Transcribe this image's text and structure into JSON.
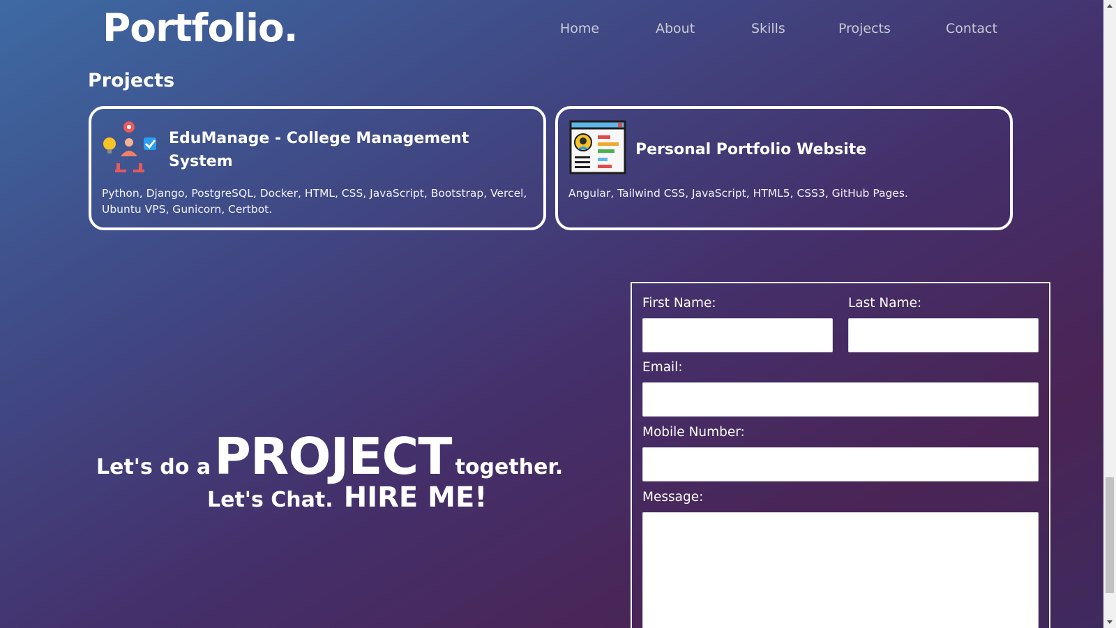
{
  "header": {
    "logo": "Portfolio.",
    "nav": [
      "Home",
      "About",
      "Skills",
      "Projects",
      "Contact"
    ]
  },
  "projects": {
    "title": "Projects",
    "items": [
      {
        "icon": "project-management-icon",
        "title": "EduManage - College Management System",
        "tech": "Python, Django, PostgreSQL, Docker, HTML, CSS, JavaScript, Bootstrap, Vercel, Ubuntu VPS, Gunicorn, Certbot."
      },
      {
        "icon": "resume-document-icon",
        "title": "Personal Portfolio Website",
        "tech": "Angular, Tailwind CSS, JavaScript, HTML5, CSS3, GitHub Pages."
      }
    ]
  },
  "cta": {
    "lead": "Let's do a",
    "big": "PROJECT",
    "tail": "together.",
    "chat": "Let's Chat.",
    "hire": "HIRE ME!"
  },
  "form": {
    "first_name_label": "First Name:",
    "last_name_label": "Last Name:",
    "email_label": "Email:",
    "mobile_label": "Mobile Number:",
    "message_label": "Message:"
  },
  "colors": {
    "gradient_start": "#3e6aa3",
    "gradient_end": "#4a2455",
    "text": "#ffffff",
    "nav_text": "#c9c9d6"
  }
}
